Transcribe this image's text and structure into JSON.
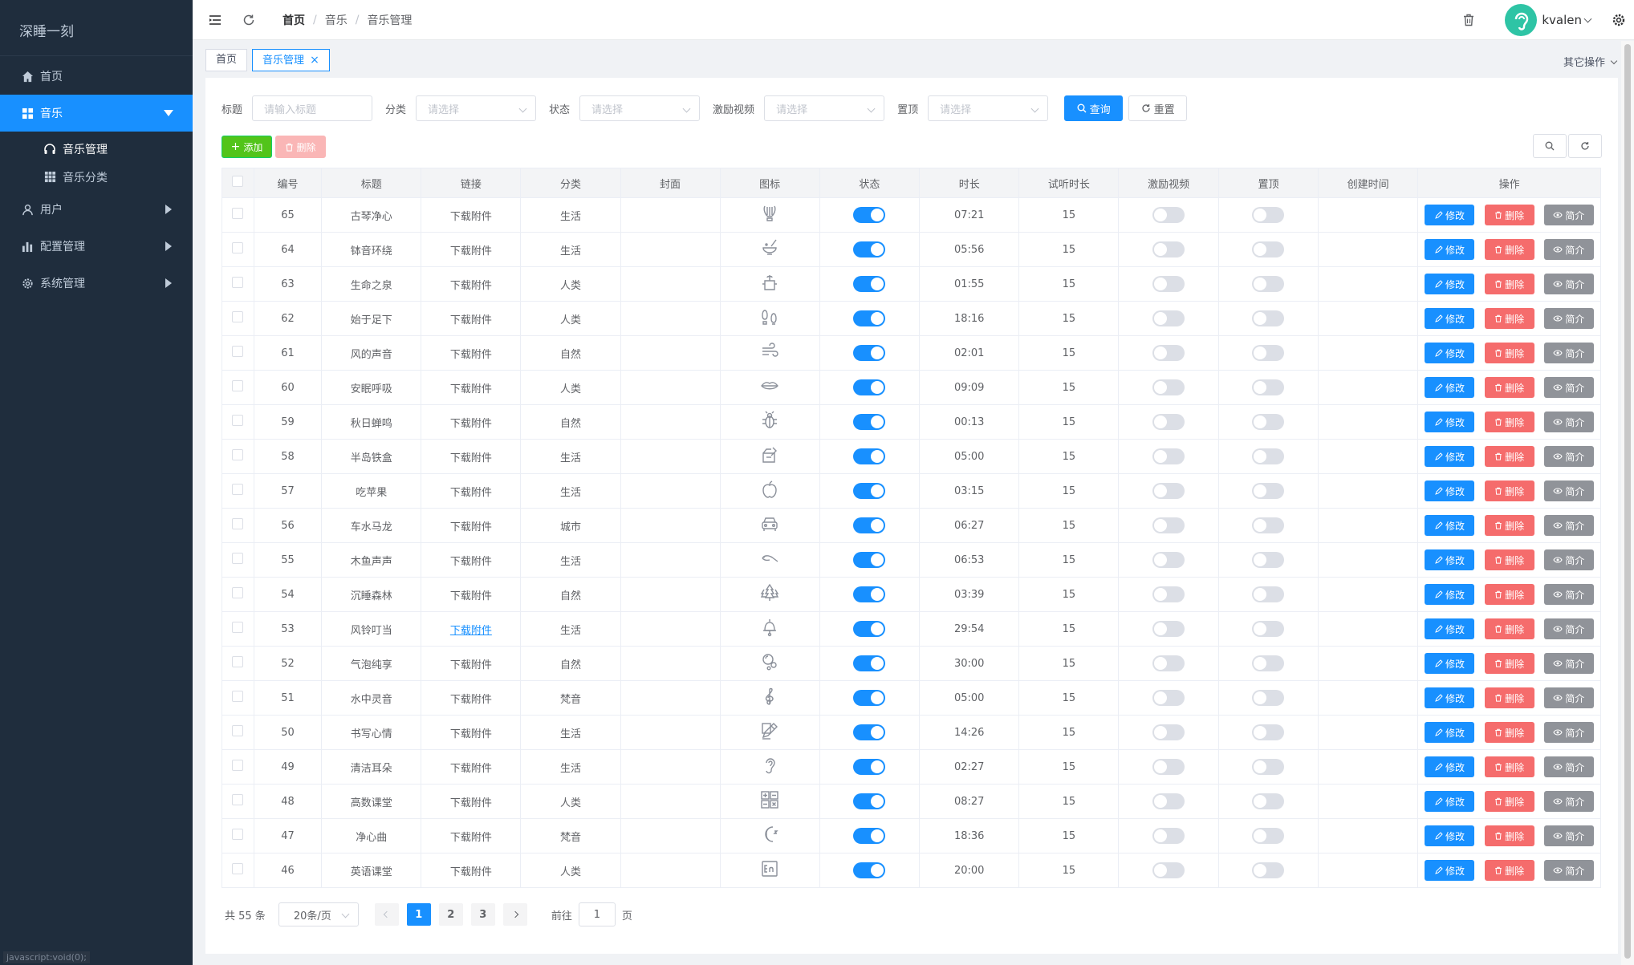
{
  "sidebar": {
    "logo": "深睡一刻",
    "home": "首页",
    "music": "音乐",
    "music_manage": "音乐管理",
    "music_category": "音乐分类",
    "users": "用户",
    "config": "配置管理",
    "system": "系统管理",
    "status_hint": "javascript:void(0);"
  },
  "header": {
    "breadcrumb": [
      "首页",
      "音乐",
      "音乐管理"
    ],
    "username": "kvalen"
  },
  "tags": {
    "home": "首页",
    "current": "音乐管理",
    "close": "×",
    "other_ops": "其它操作"
  },
  "filters": {
    "title_label": "标题",
    "title_placeholder": "请输入标题",
    "category_label": "分类",
    "status_label": "状态",
    "video_label": "激励视频",
    "top_label": "置顶",
    "select_placeholder": "请选择",
    "search": "查询",
    "reset": "重置"
  },
  "toolbar": {
    "add": "添加",
    "delete": "删除"
  },
  "table": {
    "columns": [
      "编号",
      "标题",
      "链接",
      "分类",
      "封面",
      "图标",
      "状态",
      "时长",
      "试听时长",
      "激励视频",
      "置顶",
      "创建时间",
      "操作"
    ],
    "link_text": "下载附件",
    "actions": {
      "edit": "修改",
      "delete": "删除",
      "info": "简介"
    },
    "rows": [
      {
        "id": "65",
        "title": "古琴净心",
        "category": "生活",
        "icon": "lyre-icon",
        "duration": "07:21",
        "trial": "15"
      },
      {
        "id": "64",
        "title": "钵音环绕",
        "category": "生活",
        "icon": "singing-bowl-icon",
        "duration": "05:56",
        "trial": "15"
      },
      {
        "id": "63",
        "title": "生命之泉",
        "category": "人类",
        "icon": "spring-icon",
        "duration": "01:55",
        "trial": "15"
      },
      {
        "id": "62",
        "title": "始于足下",
        "category": "人类",
        "icon": "footprints-icon",
        "duration": "18:16",
        "trial": "15"
      },
      {
        "id": "61",
        "title": "风的声音",
        "category": "自然",
        "icon": "wind-icon",
        "duration": "02:01",
        "trial": "15"
      },
      {
        "id": "60",
        "title": "安眠呼吸",
        "category": "人类",
        "icon": "lips-icon",
        "duration": "09:09",
        "trial": "15"
      },
      {
        "id": "59",
        "title": "秋日蝉鸣",
        "category": "自然",
        "icon": "bug-icon",
        "duration": "00:13",
        "trial": "15"
      },
      {
        "id": "58",
        "title": "半岛铁盒",
        "category": "生活",
        "icon": "box-icon",
        "duration": "05:00",
        "trial": "15"
      },
      {
        "id": "57",
        "title": "吃苹果",
        "category": "生活",
        "icon": "apple-icon",
        "duration": "03:15",
        "trial": "15"
      },
      {
        "id": "56",
        "title": "车水马龙",
        "category": "城市",
        "icon": "car-icon",
        "duration": "06:27",
        "trial": "15"
      },
      {
        "id": "55",
        "title": "木鱼声声",
        "category": "生活",
        "icon": "wooden-fish-icon",
        "duration": "06:53",
        "trial": "15"
      },
      {
        "id": "54",
        "title": "沉睡森林",
        "category": "自然",
        "icon": "forest-icon",
        "duration": "03:39",
        "trial": "15"
      },
      {
        "id": "53",
        "title": "风铃叮当",
        "category": "生活",
        "icon": "wind-chime-icon",
        "duration": "29:54",
        "trial": "15"
      },
      {
        "id": "52",
        "title": "气泡纯享",
        "category": "自然",
        "icon": "bubbles-icon",
        "duration": "30:00",
        "trial": "15"
      },
      {
        "id": "51",
        "title": "水中灵音",
        "category": "梵音",
        "icon": "treble-clef-icon",
        "duration": "05:00",
        "trial": "15"
      },
      {
        "id": "50",
        "title": "书写心情",
        "category": "生活",
        "icon": "pen-icon",
        "duration": "14:26",
        "trial": "15"
      },
      {
        "id": "49",
        "title": "清洁耳朵",
        "category": "生活",
        "icon": "ear-icon",
        "duration": "02:27",
        "trial": "15"
      },
      {
        "id": "48",
        "title": "高数课堂",
        "category": "人类",
        "icon": "math-icon",
        "duration": "08:27",
        "trial": "15"
      },
      {
        "id": "47",
        "title": "净心曲",
        "category": "梵音",
        "icon": "moon-icon",
        "duration": "18:36",
        "trial": "15"
      },
      {
        "id": "46",
        "title": "英语课堂",
        "category": "人类",
        "icon": "english-icon",
        "duration": "20:00",
        "trial": "15"
      }
    ]
  },
  "pager": {
    "total": "共 55 条",
    "page_size": "20条/页",
    "pages": [
      "1",
      "2",
      "3"
    ],
    "goto": "前往",
    "goto_value": "1",
    "page_unit": "页"
  },
  "colors": {
    "primary": "#1890ff",
    "sidebar": "#1f2d3d",
    "danger": "#f56c6c",
    "info": "#909399",
    "success": "#52c41a"
  }
}
